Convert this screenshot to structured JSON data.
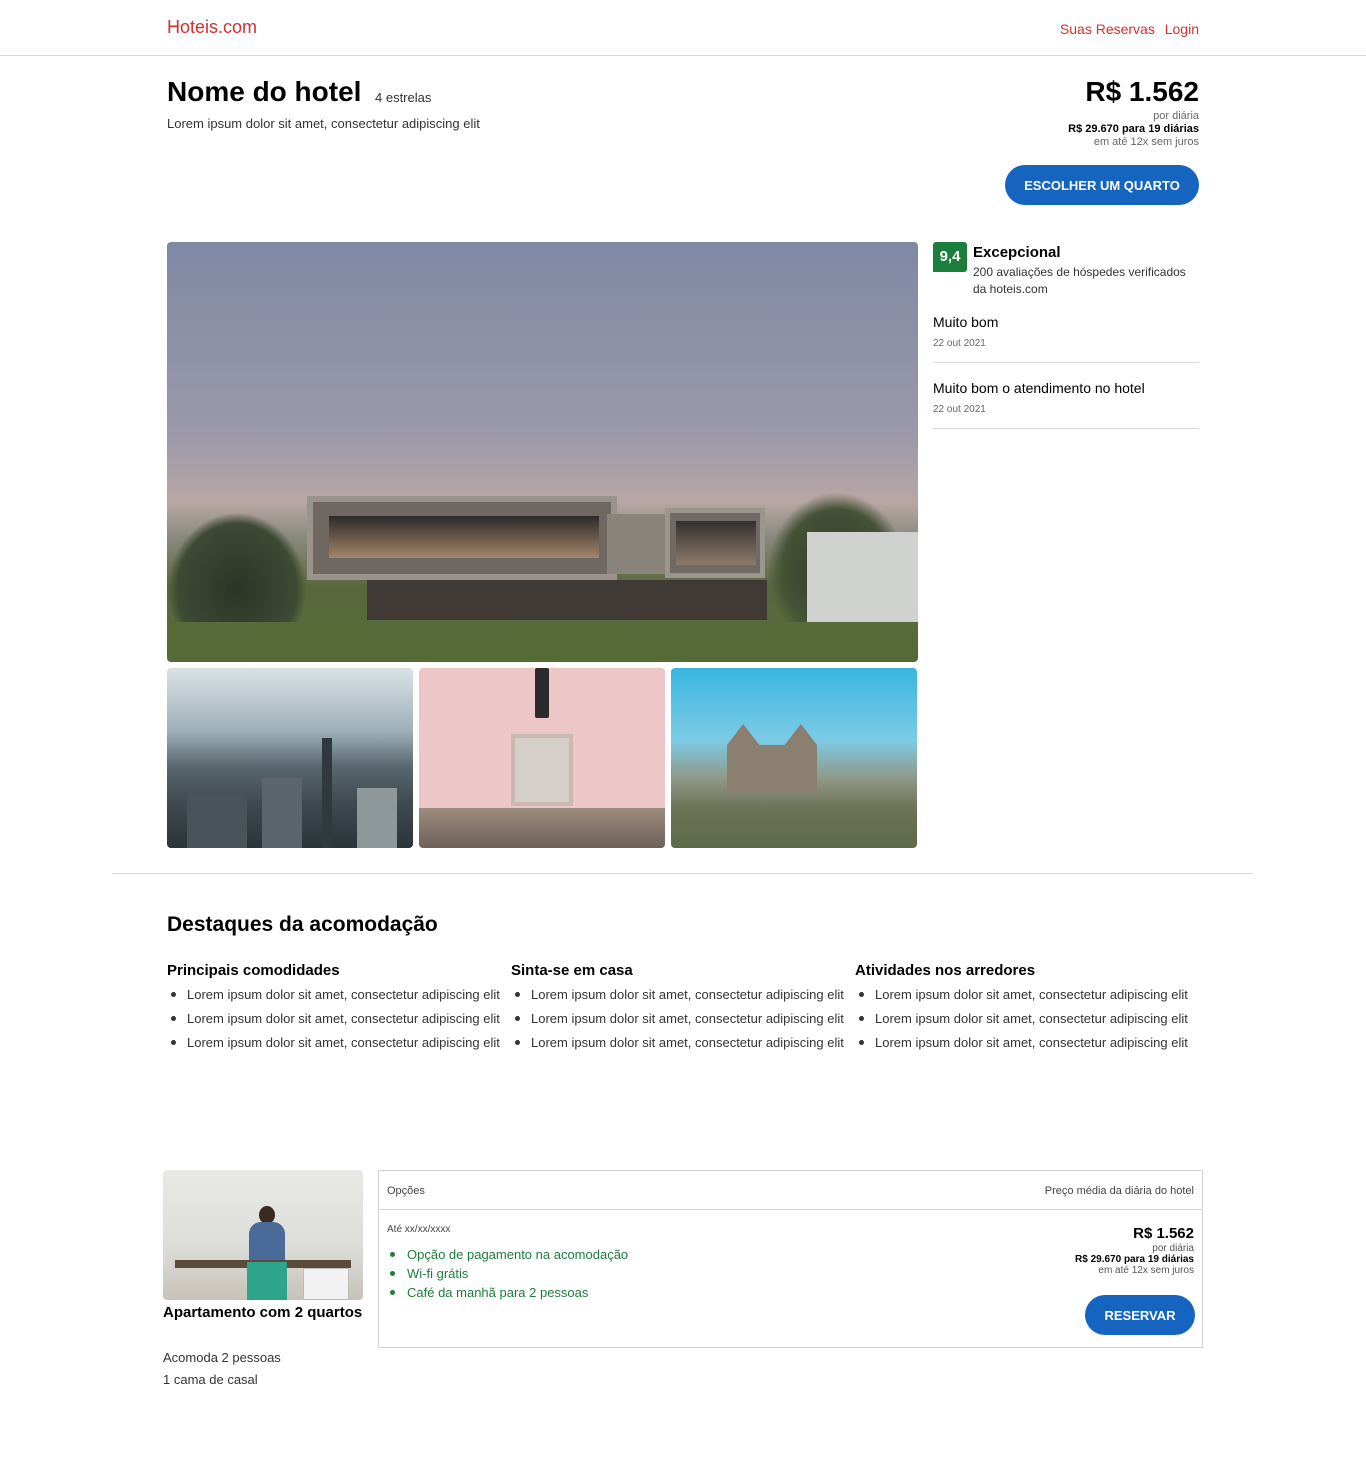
{
  "header": {
    "brand": "Hoteis.com",
    "nav": {
      "reservations": "Suas Reservas",
      "login": "Login"
    }
  },
  "hotel": {
    "name": "Nome do hotel",
    "stars": "4 estrelas",
    "description": "Lorem ipsum dolor sit amet, consectetur adipiscing elit"
  },
  "price": {
    "main": "R$ 1.562",
    "per_night": "por diária",
    "total": "R$ 29.670 para 19 diárias",
    "installments": "em até 12x sem juros",
    "choose_button": "ESCOLHER UM QUARTO"
  },
  "gallery": {
    "main_photo": "hotel-exterior",
    "thumbnails": [
      "city-skyline",
      "pink-building-door",
      "church-landscape"
    ]
  },
  "rating": {
    "score": "9,4",
    "label": "Excepcional",
    "subtitle": "200 avaliações de hóspedes verificados da hoteis.com",
    "color": "#1b7f3b"
  },
  "reviews": [
    {
      "title": "Muito bom",
      "date": "22 out 2021"
    },
    {
      "title": "Muito bom o atendimento no hotel",
      "date": "22 out 2021"
    }
  ],
  "highlights": {
    "title": "Destaques da acomodação",
    "columns": [
      {
        "heading": "Principais comodidades",
        "items": [
          "Lorem ipsum dolor sit amet, consectetur adipiscing elit",
          "Lorem ipsum dolor sit amet, consectetur adipiscing elit",
          "Lorem ipsum dolor sit amet, consectetur adipiscing elit"
        ]
      },
      {
        "heading": "Sinta-se em casa",
        "items": [
          "Lorem ipsum dolor sit amet, consectetur adipiscing elit",
          "Lorem ipsum dolor sit amet, consectetur adipiscing elit",
          "Lorem ipsum dolor sit amet, consectetur adipiscing elit"
        ]
      },
      {
        "heading": "Atividades nos arredores",
        "items": [
          "Lorem ipsum dolor sit amet, consectetur adipiscing elit",
          "Lorem ipsum dolor sit amet, consectetur adipiscing elit",
          "Lorem ipsum dolor sit amet, consectetur adipiscing elit"
        ]
      }
    ]
  },
  "room": {
    "name": "Apartamento com 2 quartos",
    "capacity": "Acomoda 2 pessoas",
    "bed": "1 cama de casal",
    "options": {
      "header_left": "Opções",
      "header_right": "Preço média da diária do hotel",
      "date": "Até xx/xx/xxxx",
      "features": [
        "Opção de pagamento na acomodação",
        "Wi-fi grátis",
        "Café da manhã para 2 pessoas"
      ],
      "price": "R$ 1.562",
      "per_night": "por diária",
      "total": "R$ 29.670 para 19 diárias",
      "installments": "em até 12x sem juros",
      "reserve_button": "RESERVAR"
    }
  },
  "colors": {
    "brand": "#d32f2f",
    "primary_button": "#1565c0",
    "feature_text": "#1b7f3b"
  }
}
